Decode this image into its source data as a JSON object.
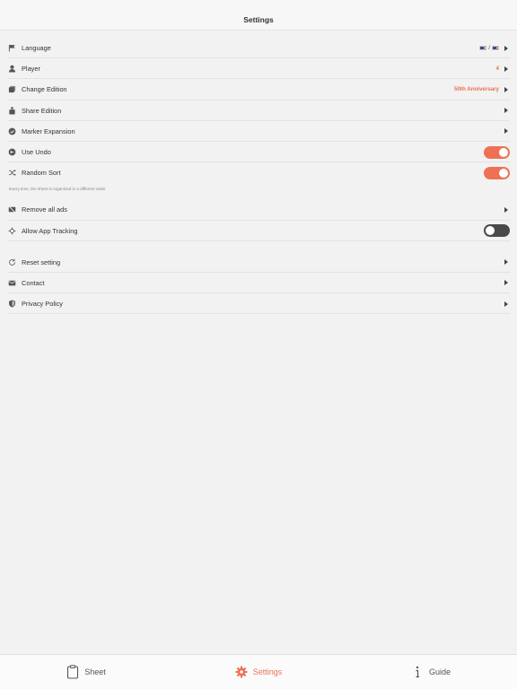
{
  "header": {
    "title": "Settings"
  },
  "settings": {
    "language": {
      "label": "Language",
      "value": "🇺🇸 / 🇺🇸",
      "separator": "/"
    },
    "player": {
      "label": "Player",
      "value": "4"
    },
    "edition": {
      "label": "Change Edition",
      "value": "50th Anniversary"
    },
    "share": {
      "label": "Share Edition"
    },
    "marker": {
      "label": "Marker Expansion"
    },
    "undo": {
      "label": "Use Undo",
      "enabled": true
    },
    "random": {
      "label": "Random Sort",
      "enabled": true,
      "footnote": "Every time, the sheet is organized in a different order"
    },
    "ads": {
      "label": "Remove all ads"
    },
    "tracking": {
      "label": "Allow App Tracking",
      "enabled": false
    },
    "reset": {
      "label": "Reset setting"
    },
    "contact": {
      "label": "Contact"
    },
    "privacy": {
      "label": "Privacy Policy"
    }
  },
  "tabs": [
    {
      "label": "Sheet",
      "icon": "clipboard-icon",
      "active": false
    },
    {
      "label": "Settings",
      "icon": "gear-icon",
      "active": true
    },
    {
      "label": "Guide",
      "icon": "info-icon",
      "active": false
    }
  ],
  "colors": {
    "accent": "#ee7155",
    "toggle_off": "#4a4a4a",
    "background": "#f2f2f2"
  }
}
